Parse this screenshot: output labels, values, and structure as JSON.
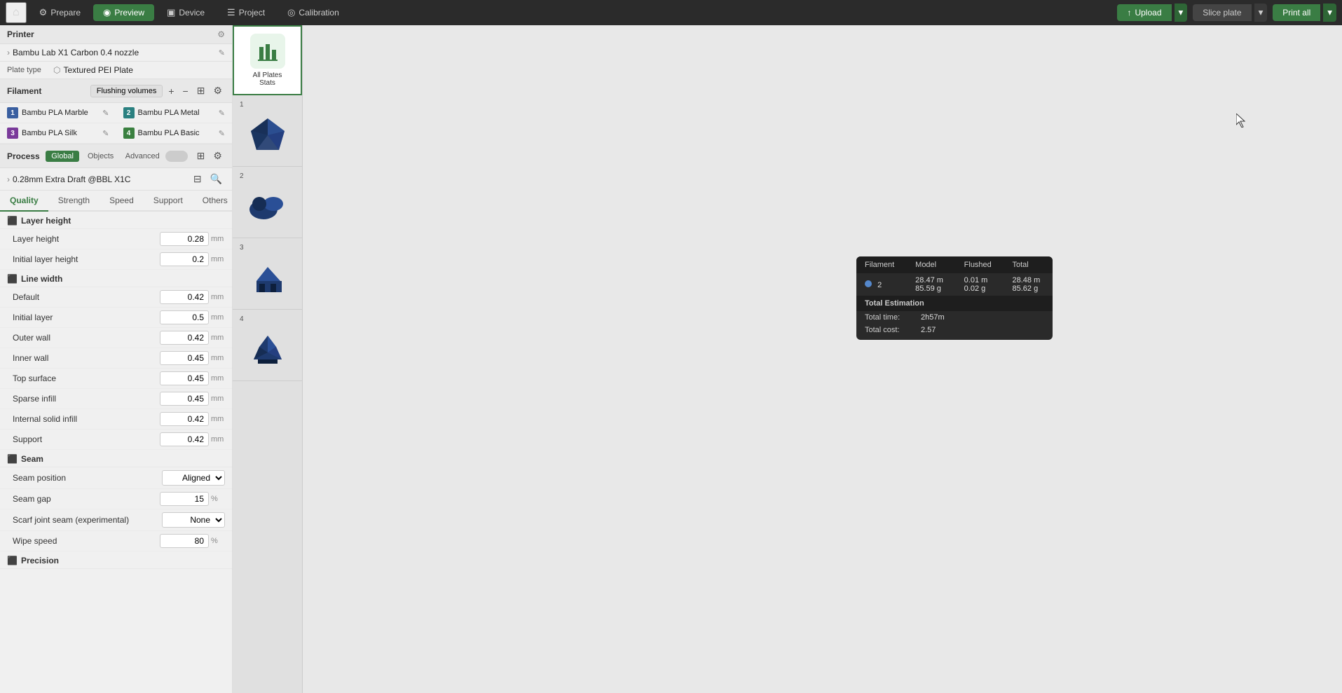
{
  "topbar": {
    "home_icon": "⌂",
    "nav_items": [
      {
        "id": "prepare",
        "label": "Prepare",
        "icon": "⚙",
        "active": false
      },
      {
        "id": "preview",
        "label": "Preview",
        "icon": "◉",
        "active": true
      },
      {
        "id": "device",
        "label": "Device",
        "icon": "▣",
        "active": false
      },
      {
        "id": "project",
        "label": "Project",
        "icon": "☰",
        "active": false
      },
      {
        "id": "calibration",
        "label": "Calibration",
        "icon": "◎",
        "active": false
      }
    ],
    "upload_label": "Upload",
    "slice_label": "Slice plate",
    "print_label": "Print all"
  },
  "printer": {
    "section_label": "Printer",
    "name": "Bambu Lab X1 Carbon 0.4 nozzle",
    "plate_type_label": "Plate type",
    "plate_type_value": "Textured PEI Plate"
  },
  "filament": {
    "section_label": "Filament",
    "flush_btn": "Flushing volumes",
    "items": [
      {
        "num": "1",
        "name": "Bambu PLA Marble",
        "color": "#3a5fa0"
      },
      {
        "num": "2",
        "name": "Bambu PLA Metal",
        "color": "#2a8080"
      },
      {
        "num": "3",
        "name": "Bambu PLA Silk",
        "color": "#7a3a9a"
      },
      {
        "num": "4",
        "name": "Bambu PLA Basic",
        "color": "#3a8040"
      }
    ]
  },
  "process": {
    "section_label": "Process",
    "tab_global": "Global",
    "tab_objects": "Objects",
    "advanced_label": "Advanced",
    "preset_name": "0.28mm Extra Draft @BBL X1C"
  },
  "quality_tabs": [
    "Quality",
    "Strength",
    "Speed",
    "Support",
    "Others"
  ],
  "quality": {
    "layer_height_section": "Layer height",
    "layer_height_label": "Layer height",
    "layer_height_value": "0.28",
    "layer_height_unit": "mm",
    "initial_layer_height_label": "Initial layer height",
    "initial_layer_height_value": "0.2",
    "initial_layer_height_unit": "mm",
    "line_width_section": "Line width",
    "line_width_items": [
      {
        "label": "Default",
        "value": "0.42",
        "unit": "mm"
      },
      {
        "label": "Initial layer",
        "value": "0.5",
        "unit": "mm"
      },
      {
        "label": "Outer wall",
        "value": "0.42",
        "unit": "mm"
      },
      {
        "label": "Inner wall",
        "value": "0.45",
        "unit": "mm"
      },
      {
        "label": "Top surface",
        "value": "0.45",
        "unit": "mm"
      },
      {
        "label": "Sparse infill",
        "value": "0.45",
        "unit": "mm"
      },
      {
        "label": "Internal solid infill",
        "value": "0.42",
        "unit": "mm"
      },
      {
        "label": "Support",
        "value": "0.42",
        "unit": "mm"
      }
    ],
    "seam_section": "Seam",
    "seam_items": [
      {
        "label": "Seam position",
        "value": "Aligned",
        "unit": "",
        "dropdown": true
      },
      {
        "label": "Seam gap",
        "value": "15",
        "unit": "%"
      },
      {
        "label": "Scarf joint seam (experimental)",
        "value": "None",
        "unit": "",
        "dropdown": true
      },
      {
        "label": "Wipe speed",
        "value": "80",
        "unit": "%"
      }
    ],
    "precision_section": "Precision"
  },
  "plates": [
    {
      "num": "1",
      "label": "Plate 1"
    },
    {
      "num": "2",
      "label": "Plate 2"
    },
    {
      "num": "3",
      "label": "Plate 3"
    },
    {
      "num": "4",
      "label": "Plate 4"
    }
  ],
  "stats_panel": {
    "title": "All Plates Stats",
    "icon_label": "📊",
    "table_headers": [
      "Filament",
      "Model",
      "Flushed",
      "Total"
    ],
    "rows": [
      {
        "filament_num": "2",
        "model_m": "28.47 m",
        "model_g": "85.59 g",
        "flushed_m": "0.01 m",
        "flushed_g": "0.02 g",
        "total_m": "28.48 m",
        "total_g": "85.62 g"
      }
    ],
    "total_estimation_label": "Total Estimation",
    "total_time_label": "Total time:",
    "total_time_value": "2h57m",
    "total_cost_label": "Total cost:",
    "total_cost_value": "2.57"
  }
}
